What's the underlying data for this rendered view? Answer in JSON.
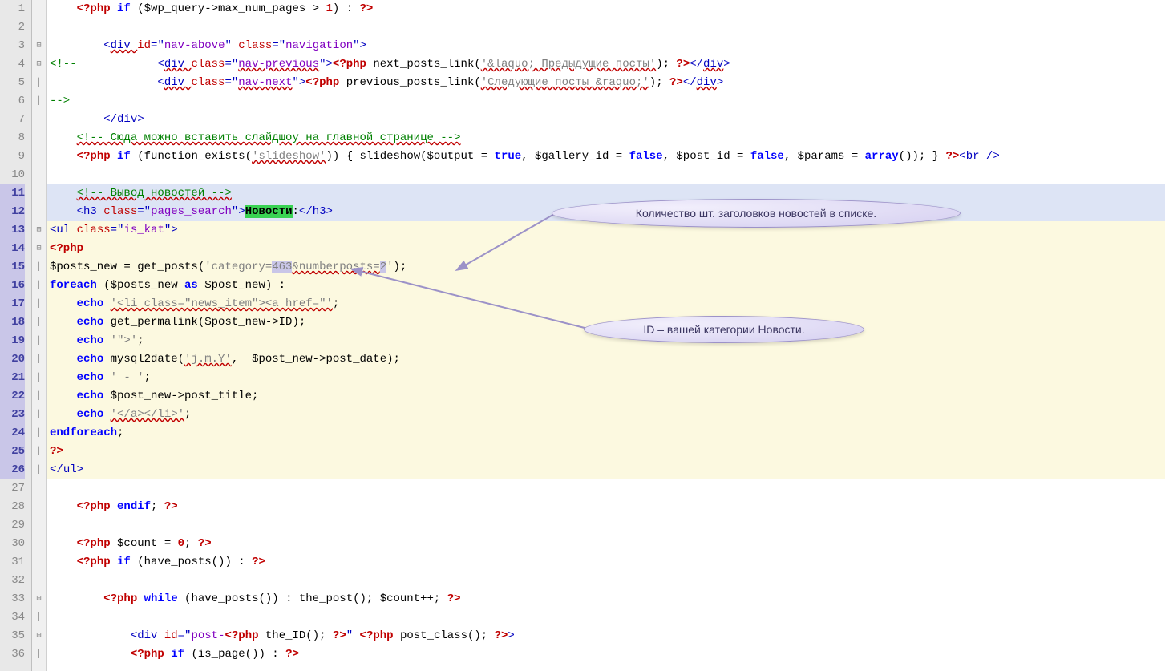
{
  "lines": {
    "l1": [
      "    ",
      "<?php",
      " ",
      "if",
      " ($wp_query->max_num_pages > ",
      "1",
      ") : ",
      "?>"
    ],
    "l3": [
      "        ",
      "<",
      "div ",
      "id",
      "=\"",
      "nav-above",
      "\" ",
      "class",
      "=\"",
      "navigation",
      "\">"
    ],
    "l4": [
      "<!--",
      "            ",
      "<",
      "div ",
      "class",
      "=\"",
      "nav-previous",
      "\">",
      "<?php",
      " next_posts_link(",
      "'&laquo; Предыдущие посты'",
      "); ",
      "?>",
      "</",
      "div",
      ">"
    ],
    "l5": [
      "                ",
      "<",
      "div ",
      "class",
      "=\"",
      "nav-next",
      "\">",
      "<?php",
      " previous_posts_link(",
      "'Следующие посты &raquo;'",
      "); ",
      "?>",
      "</",
      "div",
      ">"
    ],
    "l6": [
      "-->"
    ],
    "l7": [
      "        ",
      "</",
      "div",
      ">"
    ],
    "l8": [
      "    ",
      "<!-- Сюда можно вставить слайдшоу на главной странице -->"
    ],
    "l9": [
      "    ",
      "<?php",
      " ",
      "if",
      " (function_exists(",
      "'slideshow'",
      ")) { slideshow($output = ",
      "true",
      ", $gallery_id = ",
      "false",
      ", $post_id = ",
      "false",
      ", $params = ",
      "array",
      "()); } ",
      "?>",
      "<",
      "br ",
      "/>"
    ],
    "l11": [
      "    ",
      "<!-- Вывод новостей -->"
    ],
    "l12": [
      "    ",
      "<",
      "h3 ",
      "class",
      "=\"",
      "pages_search",
      "\">",
      "Новости",
      ":",
      "</",
      "h3",
      ">"
    ],
    "l13": [
      "<",
      "ul ",
      "class",
      "=\"",
      "is_kat",
      "\">"
    ],
    "l14": [
      "<?php"
    ],
    "l15": [
      "$posts_new = get_posts(",
      "'category=",
      "463",
      "&numberposts=",
      "2",
      "'",
      ");"
    ],
    "l16": [
      "foreach",
      " ($posts_new ",
      "as",
      " $post_new) :"
    ],
    "l17": [
      "    ",
      "echo",
      " ",
      "'<li class=\"news_item\"><a href=\"'",
      ";"
    ],
    "l18": [
      "    ",
      "echo",
      " get_permalink($post_new->ID);"
    ],
    "l19": [
      "    ",
      "echo",
      " ",
      "'\">'",
      ";"
    ],
    "l20": [
      "    ",
      "echo",
      " mysql2date(",
      "'j.m.Y'",
      ",  $post_new->post_date);"
    ],
    "l21": [
      "    ",
      "echo",
      " ",
      "' - '",
      ";"
    ],
    "l22": [
      "    ",
      "echo",
      " $post_new->post_title;"
    ],
    "l23": [
      "    ",
      "echo",
      " ",
      "'</a></li>'",
      ";"
    ],
    "l24": [
      "endforeach",
      ";"
    ],
    "l25": [
      "?>"
    ],
    "l26": [
      "</",
      "ul",
      ">"
    ],
    "l28": [
      "    ",
      "<?php",
      " ",
      "endif",
      "; ",
      "?>"
    ],
    "l30": [
      "    ",
      "<?php",
      " $count = ",
      "0",
      "; ",
      "?>"
    ],
    "l31": [
      "    ",
      "<?php",
      " ",
      "if",
      " (have_posts()) : ",
      "?>"
    ],
    "l33": [
      "        ",
      "<?php",
      " ",
      "while",
      " (have_posts()) : the_post(); $count++; ",
      "?>"
    ],
    "l35": [
      "            ",
      "<",
      "div ",
      "id",
      "=\"",
      "post-",
      "<?php",
      " the_ID(); ",
      "?>",
      "\" ",
      "<?php",
      " post_class(); ",
      "?>",
      ">"
    ],
    "l36": [
      "            ",
      "<?php",
      " ",
      "if",
      " (is_page()) : ",
      "?>"
    ]
  },
  "callouts": {
    "c1": "Количество шт. заголовков новостей в списке.",
    "c2": "ID – вашей категории Новости."
  },
  "line_numbers": [
    "1",
    "2",
    "3",
    "4",
    "5",
    "6",
    "7",
    "8",
    "9",
    "10",
    "11",
    "12",
    "13",
    "14",
    "15",
    "16",
    "17",
    "18",
    "19",
    "20",
    "21",
    "22",
    "23",
    "24",
    "25",
    "26",
    "27",
    "28",
    "29",
    "30",
    "31",
    "32",
    "33",
    "34",
    "35",
    "36"
  ],
  "fold_marks": {
    "3": "⊟",
    "4": "⊟",
    "13": "⊟",
    "14": "⊟",
    "33": "⊟",
    "35": "⊟"
  }
}
